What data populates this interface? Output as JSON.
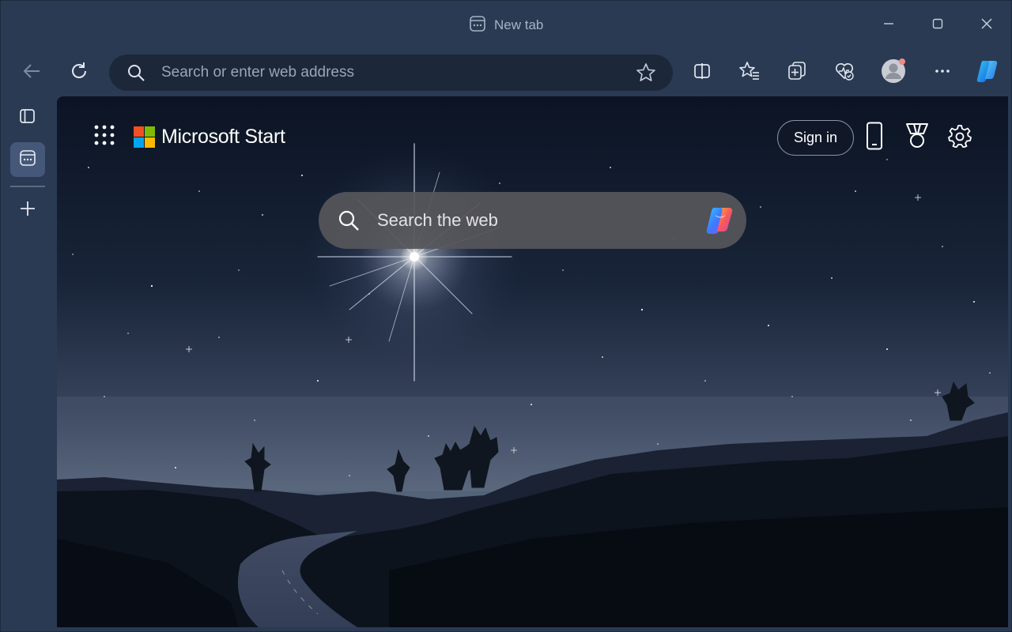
{
  "titlebar": {
    "tab_title": "New tab",
    "controls": [
      "minimize-icon",
      "maximize-icon",
      "close-icon"
    ]
  },
  "toolbar": {
    "address_placeholder": "Search or enter web address",
    "icons": [
      "back-icon",
      "refresh-icon",
      "search-icon",
      "favorite-star-icon",
      "split-screen-icon",
      "favorites-icon",
      "collections-icon",
      "browser-essentials-icon",
      "profile-avatar",
      "more-icon",
      "copilot-icon"
    ]
  },
  "sidebar": {
    "icons": [
      "tab-actions-icon",
      "new-tab-page-icon",
      "new-tab-plus-icon"
    ]
  },
  "page": {
    "brand": "Microsoft Start",
    "sign_in": "Sign in",
    "search_placeholder": "Search the web",
    "icons": [
      "apps-launcher-icon",
      "phone-icon",
      "rewards-icon",
      "settings-icon",
      "copilot-icon"
    ]
  },
  "colors": {
    "frame": "#2a3a53",
    "address_bg": "#1c273a",
    "content_bg": "#111a2e",
    "search_bg": "#56565a",
    "ms_red": "#f25022",
    "ms_green": "#7fba00",
    "ms_blue": "#00a4ef",
    "ms_yellow": "#ffb900"
  }
}
